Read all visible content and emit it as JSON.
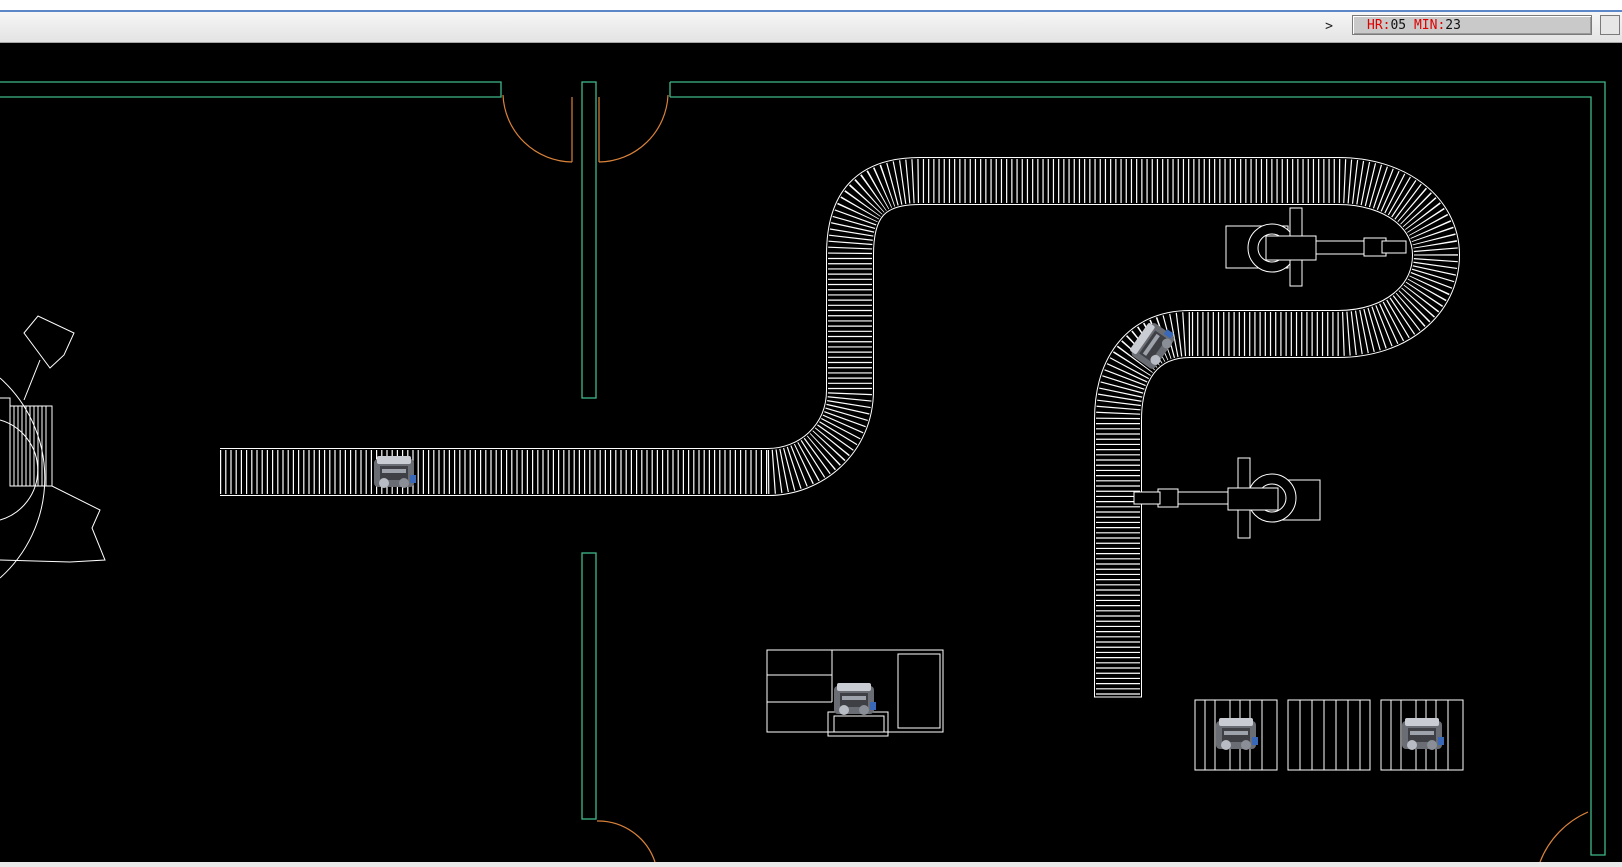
{
  "toolbar": {
    "expand_glyph": ">",
    "clock": {
      "hr_label": "HR:",
      "hr_value": "05",
      "min_label": "MIN:",
      "min_value": "23"
    }
  },
  "colors": {
    "background": "#000000",
    "wall": "#3fb889",
    "door": "#d9823a",
    "equipment": "#ffffff",
    "clock_label": "#e00000"
  },
  "scene": {
    "conveyors": [
      {
        "name": "left-straight-conveyor"
      },
      {
        "name": "serpentine-conveyor"
      },
      {
        "name": "vertical-outbound-conveyor"
      }
    ],
    "robots": [
      {
        "name": "robot-arm-upper"
      },
      {
        "name": "robot-arm-lower"
      }
    ],
    "engines": [
      {
        "name": "engine-on-left-conveyor"
      },
      {
        "name": "engine-on-curve"
      },
      {
        "name": "engine-at-workstation"
      },
      {
        "name": "engine-on-pallet-1"
      },
      {
        "name": "engine-on-pallet-3"
      }
    ],
    "pallets": [
      {
        "name": "pallet-1",
        "loaded": true
      },
      {
        "name": "pallet-2",
        "loaded": false
      },
      {
        "name": "pallet-3",
        "loaded": true
      }
    ]
  }
}
